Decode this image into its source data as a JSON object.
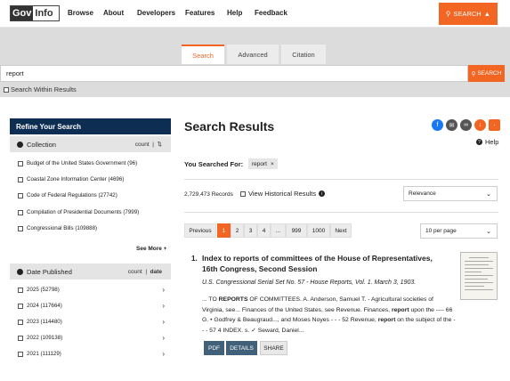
{
  "header": {
    "logo_part1": "Gov",
    "logo_part2": "Info",
    "nav": [
      "Browse",
      "About",
      "Developers",
      "Features",
      "Help",
      "Feedback"
    ],
    "search_button": "SEARCH"
  },
  "search_tabs": [
    "Search",
    "Advanced",
    "Citation"
  ],
  "search": {
    "query": "report",
    "button": "SEARCH",
    "within_label": "Search Within Results"
  },
  "sidebar": {
    "title": "Refine Your Search",
    "collection": {
      "label": "Collection",
      "sort_label": "count",
      "items": [
        "Budget of the United States Government (96)",
        "Coastal Zone Information Center (4696)",
        "Code of Federal Regulations (27742)",
        "Compilation of Presidential Documents (7999)",
        "Congressional Bills (109888)"
      ],
      "see_more": "See More +"
    },
    "date": {
      "label": "Date Published",
      "sort_count": "count",
      "sort_date": "date",
      "items": [
        "2025 (52798)",
        "2024 (117664)",
        "2023 (114480)",
        "2022 (109138)",
        "2021 (111129)"
      ]
    }
  },
  "results": {
    "heading": "Search Results",
    "help": "Help",
    "you_searched_label": "You Searched For:",
    "chip": "report",
    "records": "2,729,473 Records",
    "historical": "View Historical Results",
    "sort_select": "Relevance",
    "per_page_select": "10 per page",
    "pagination": [
      "Previous",
      "1",
      "2",
      "3",
      "4",
      "...",
      "999",
      "1000",
      "Next"
    ],
    "items": [
      {
        "num": "1.",
        "title": "Index to reports of committees of the House of Representatives, 16th Congress, Second Session",
        "subtitle": "U.S. Congressional Serial Set No. 57 - House Reports, Vol. 1. March 3, 1903.",
        "snippet_html_parts": [
          "... TO ",
          "REPORTS",
          " OF COMMITTEES. A. Anderson, Samuel T. - Agricultural societies of Virginia, see... Finances of the United States, see Revenue. Finances, ",
          "report",
          " upon the ---- 66 G. • Godfrey & Beaugraud..., and Moses Noyes - - - 52 Revenue, ",
          "report",
          " on the subject of the - - - 57 4 INDEX. s. ✓ Seward, Daniel..."
        ],
        "buttons": [
          "PDF",
          "DETAILS",
          "SHARE"
        ]
      }
    ]
  },
  "colors": {
    "accent": "#f26522",
    "navy": "#0d2d52",
    "button_dark": "#41607a"
  }
}
